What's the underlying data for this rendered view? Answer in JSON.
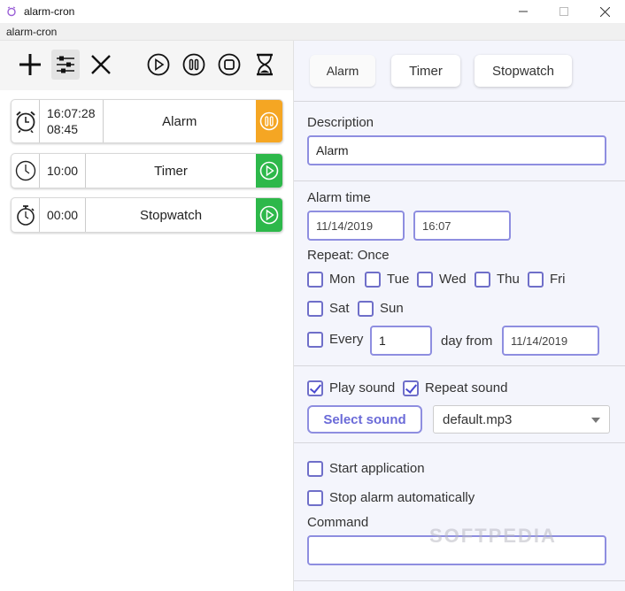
{
  "window": {
    "title": "alarm-cron",
    "menu_label": "alarm-cron",
    "controls": [
      "minimize-icon",
      "maximize-icon",
      "close-icon"
    ]
  },
  "toolbar": {
    "buttons": [
      "plus-icon",
      "settings-sliders-icon",
      "close-x-icon",
      "play-circle-icon",
      "pause-circle-icon",
      "stop-circle-icon",
      "hourglass-icon"
    ]
  },
  "items": [
    {
      "type": "alarm",
      "icon": "alarm-clock-icon",
      "time": "16:07:28",
      "subtime": "08:45",
      "name": "Alarm",
      "action": "pause",
      "color": "#f5a623"
    },
    {
      "type": "timer",
      "icon": "clock-icon",
      "time": "10:00",
      "name": "Timer",
      "action": "play",
      "color": "#2db84a"
    },
    {
      "type": "stopwatch",
      "icon": "stopwatch-icon",
      "time": "00:00",
      "name": "Stopwatch",
      "action": "play",
      "color": "#2db84a"
    }
  ],
  "tabs": [
    {
      "label": "Alarm",
      "selected": true
    },
    {
      "label": "Timer",
      "selected": false
    },
    {
      "label": "Stopwatch",
      "selected": false
    }
  ],
  "form": {
    "description_label": "Description",
    "description_value": "Alarm",
    "alarm_time_label": "Alarm time",
    "date_value": "11/14/2019",
    "time_value": "16:07",
    "repeat_label": "Repeat: Once",
    "days": [
      {
        "label": "Mon",
        "checked": false
      },
      {
        "label": "Tue",
        "checked": false
      },
      {
        "label": "Wed",
        "checked": false
      },
      {
        "label": "Thu",
        "checked": false
      },
      {
        "label": "Fri",
        "checked": false
      },
      {
        "label": "Sat",
        "checked": false
      },
      {
        "label": "Sun",
        "checked": false
      }
    ],
    "every_label": "Every",
    "every_value": "1",
    "day_from_label": "day from",
    "day_from_value": "11/14/2019",
    "play_sound_label": "Play sound",
    "play_sound_checked": true,
    "repeat_sound_label": "Repeat sound",
    "repeat_sound_checked": true,
    "select_sound_label": "Select sound",
    "sound_file": "default.mp3",
    "start_app_label": "Start application",
    "stop_auto_label": "Stop alarm automatically",
    "command_label": "Command",
    "command_value": ""
  },
  "watermark": "SOFTPEDIA",
  "colors": {
    "accent": "#8e8ee0",
    "accent_text": "#6a6ad8",
    "pause": "#f5a623",
    "play": "#2db84a",
    "panel_bg": "#f4f5fc"
  }
}
